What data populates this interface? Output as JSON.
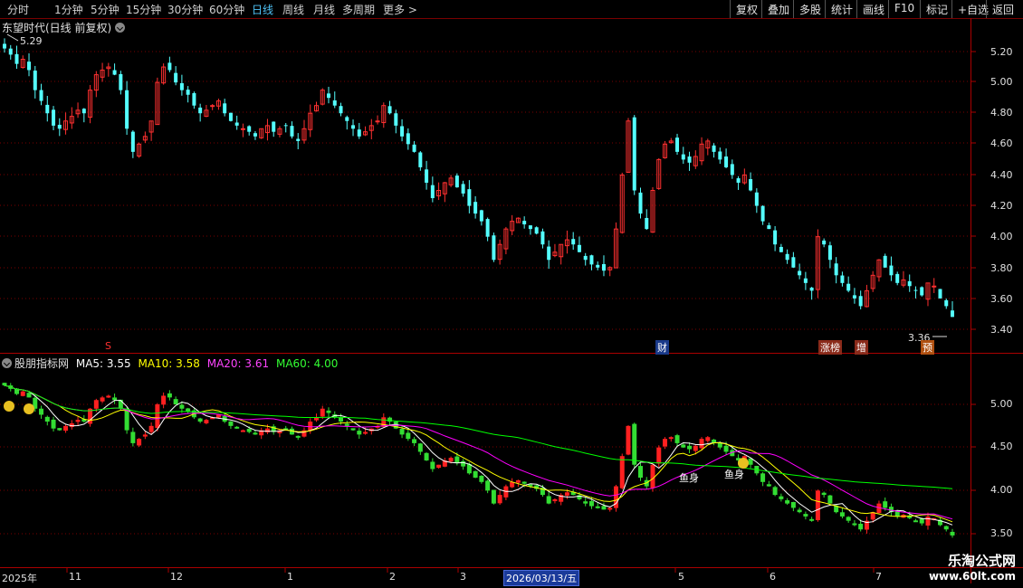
{
  "toolbar": {
    "periods": [
      "分时",
      "1分钟",
      "5分钟",
      "15分钟",
      "30分钟",
      "60分钟",
      "日线",
      "周线",
      "月线",
      "多周期",
      "更多"
    ],
    "active_period": "日线",
    "more_arrow": ">",
    "right_buttons": [
      "复权",
      "叠加",
      "多股",
      "统计",
      "画线",
      "F10",
      "标记",
      "+自选",
      "返回"
    ]
  },
  "main_panel": {
    "title": "东望时代(日线 前复权)",
    "high_label": "5.29",
    "low_label": "3.36",
    "price_ticks": [
      "5.20",
      "5.00",
      "4.80",
      "4.60",
      "4.40",
      "4.20",
      "4.00",
      "3.80",
      "3.60",
      "3.40"
    ],
    "markers": [
      {
        "text": "S",
        "color": "#ff3030"
      },
      {
        "text": "财",
        "color": "#ffffff",
        "bg": "#1a3a8a"
      },
      {
        "text": "涨榜",
        "color": "#ffffff",
        "bg": "#8a2a1a"
      },
      {
        "text": "增",
        "color": "#ffffff",
        "bg": "#8a2a1a"
      },
      {
        "text": "预",
        "color": "#ffffff",
        "bg": "#b05010"
      }
    ]
  },
  "indicator_panel": {
    "name": "股朋指标网",
    "ma5_label": "MA5:",
    "ma5_value": "3.55",
    "ma10_label": "MA10:",
    "ma10_value": "3.58",
    "ma20_label": "MA20:",
    "ma20_value": "3.61",
    "ma60_label": "MA60:",
    "ma60_value": "4.00",
    "ticks": [
      "5.00",
      "4.50",
      "4.00",
      "3.50"
    ],
    "fish_label": "鱼身",
    "colors": {
      "ma5": "#ffffff",
      "ma10": "#ffff00",
      "ma20": "#ff00ff",
      "ma60": "#00ff00"
    }
  },
  "date_axis": {
    "labels": [
      "2025年",
      "11",
      "12",
      "1",
      "2",
      "3",
      "5",
      "6",
      "7"
    ],
    "cursor_date": "2026/03/13/五"
  },
  "watermark": {
    "line1": "乐淘公式网",
    "line2": "www.60lt.com"
  },
  "colors": {
    "up": "#ff3030",
    "down": "#54ffff",
    "grid": "#7a0000",
    "ind_up": "#ff2020",
    "ind_down": "#33dd33"
  },
  "chart_data": {
    "type": "candlestick",
    "y_range_main": [
      3.36,
      5.29
    ],
    "closes": [
      5.22,
      5.18,
      5.12,
      5.15,
      5.08,
      4.95,
      4.88,
      4.8,
      4.72,
      4.7,
      4.75,
      4.78,
      4.82,
      4.8,
      4.95,
      5.05,
      5.08,
      5.1,
      5.05,
      4.95,
      4.7,
      4.55,
      4.6,
      4.65,
      4.75,
      5.0,
      5.1,
      5.08,
      5.0,
      4.95,
      4.92,
      4.85,
      4.8,
      4.82,
      4.85,
      4.88,
      4.8,
      4.75,
      4.72,
      4.7,
      4.68,
      4.65,
      4.7,
      4.72,
      4.68,
      4.7,
      4.72,
      4.65,
      4.62,
      4.7,
      4.8,
      4.85,
      4.95,
      4.9,
      4.85,
      4.8,
      4.75,
      4.7,
      4.65,
      4.68,
      4.72,
      4.75,
      4.85,
      4.8,
      4.72,
      4.65,
      4.6,
      4.55,
      4.45,
      4.35,
      4.25,
      4.3,
      4.35,
      4.38,
      4.32,
      4.28,
      4.2,
      4.15,
      4.1,
      4.0,
      3.85,
      3.95,
      4.05,
      4.1,
      4.12,
      4.08,
      4.05,
      4.02,
      3.95,
      3.85,
      3.9,
      3.95,
      3.98,
      3.95,
      3.9,
      3.85,
      3.82,
      3.8,
      3.78,
      3.8,
      4.05,
      4.4,
      4.75,
      4.3,
      4.15,
      4.05,
      4.3,
      4.5,
      4.6,
      4.62,
      4.55,
      4.5,
      4.48,
      4.52,
      4.6,
      4.62,
      4.55,
      4.5,
      4.45,
      4.4,
      4.35,
      4.4,
      4.3,
      4.2,
      4.1,
      4.05,
      3.95,
      3.9,
      3.85,
      3.8,
      3.75,
      3.7,
      3.65,
      4.0,
      3.95,
      3.85,
      3.75,
      3.7,
      3.65,
      3.6,
      3.55,
      3.65,
      3.75,
      3.85,
      3.8,
      3.75,
      3.7,
      3.72,
      3.68,
      3.65,
      3.62,
      3.7,
      3.68,
      3.6,
      3.55,
      3.48
    ]
  }
}
